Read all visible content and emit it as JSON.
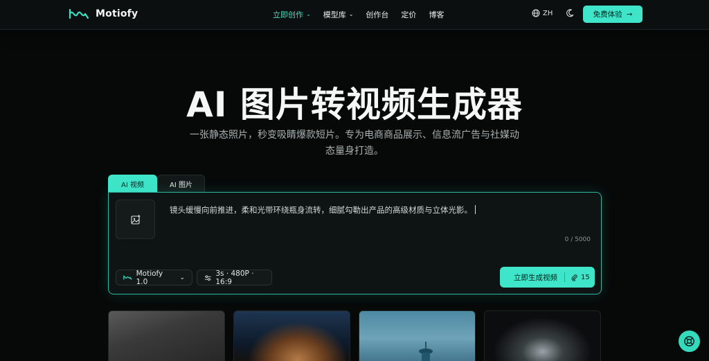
{
  "brand": {
    "name": "Motiofy",
    "accent": "#3fe5c8"
  },
  "nav": {
    "items": [
      {
        "label": "立即创作",
        "has_dropdown": true,
        "active": true
      },
      {
        "label": "模型库",
        "has_dropdown": true,
        "active": false
      },
      {
        "label": "创作台",
        "has_dropdown": false,
        "active": false
      },
      {
        "label": "定价",
        "has_dropdown": false,
        "active": false
      },
      {
        "label": "博客",
        "has_dropdown": false,
        "active": false
      }
    ],
    "language": "ZH",
    "cta_label": "免费体验"
  },
  "hero": {
    "title": "AI 图片转视频生成器",
    "subtitle": "一张静态照片，秒变吸睛爆款短片。专为电商商品展示、信息流广告与社媒动态量身打造。"
  },
  "tabs": [
    {
      "label": "AI 视频",
      "active": true
    },
    {
      "label": "AI 图片",
      "active": false
    }
  ],
  "composer": {
    "prompt": "镜头缓慢向前推进，柔和光带环绕瓶身流转，细腻勾勒出产品的高级材质与立体光影。",
    "counter": "0 / 5000",
    "model_label": "Motiofy 1.0",
    "settings_label": "3s · 480P · 16:9",
    "generate_label": "立即生成视频",
    "generate_cost": "15"
  },
  "gallery": {
    "thumbnail_count": 4
  },
  "icons": {
    "logo": "wave-logo-icon",
    "language": "globe-icon",
    "theme": "moon-icon",
    "cta": "arrow-right-icon",
    "upload": "image-upload-icon",
    "settings": "sliders-icon",
    "cost": "paperclip-icon",
    "help": "lifebuoy-icon"
  }
}
